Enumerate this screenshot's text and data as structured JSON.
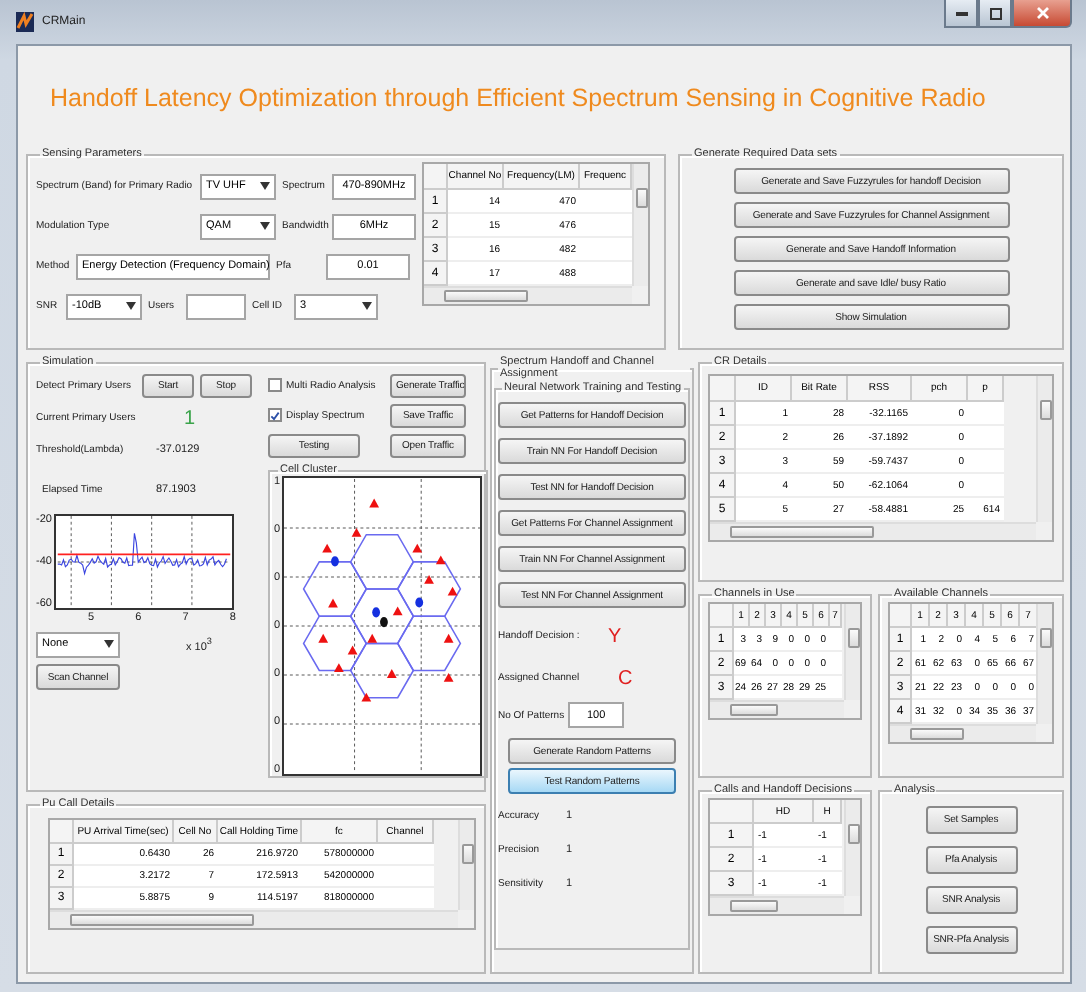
{
  "window": {
    "title": "CRMain"
  },
  "heading": "Handoff Latency Optimization  through Efficient Spectrum Sensing in Cognitive Radio",
  "sensing": {
    "title": "Sensing Parameters",
    "lines": [
      {
        "controls": [
          {
            "kind": "dropdown",
            "label": "Spectrum (Band) for Primary Radio",
            "value": "TV UHF"
          },
          {
            "kind": "input",
            "label": "Spectrum",
            "value": "470-890MHz"
          }
        ]
      },
      {
        "controls": [
          {
            "kind": "dropdown",
            "label": "Modulation Type",
            "value": "QAM"
          },
          {
            "kind": "input",
            "label": "Bandwidth",
            "value": "6MHz"
          }
        ]
      },
      {
        "controls": [
          {
            "kind": "dropdown",
            "label": "Method",
            "value": "Energy Detection (Frequency Domain)"
          },
          {
            "kind": "input",
            "label": "Pfa",
            "value": "0.01"
          }
        ]
      },
      {
        "controls": [
          {
            "kind": "dropdown",
            "label": "SNR",
            "value": "-10dB"
          },
          {
            "kind": "input",
            "label": "Users"
          },
          {
            "kind": "dropdown",
            "label": "Cell ID",
            "value": "3"
          }
        ]
      }
    ],
    "table": {
      "columns": [
        "Channel No",
        "Frequency(LM)",
        "Frequenc"
      ],
      "rows": [
        {
          "header": "1",
          "cells": [
            "14",
            "470"
          ]
        },
        {
          "header": "2",
          "cells": [
            "15",
            "476"
          ]
        },
        {
          "header": "3",
          "cells": [
            "16",
            "482"
          ]
        },
        {
          "header": "4",
          "cells": [
            "17",
            "488"
          ]
        }
      ]
    }
  },
  "generate": {
    "title": "Generate Required Data sets",
    "buttons": [
      "Generate and Save  Fuzzyrules for handoff Decision",
      "Generate and Save Fuzzyrules for Channel Assignment",
      "Generate and Save Handoff Information",
      "Generate and save Idle/ busy Ratio",
      "Show Simulation"
    ]
  },
  "simulation": {
    "title": "Simulation",
    "detect": {
      "label": "Detect Primary Users",
      "start": "Start",
      "stop": "Stop"
    },
    "checks": [
      {
        "label": "Multi Radio Analysis",
        "checked": false
      },
      {
        "label": "Display Spectrum",
        "checked": true
      }
    ],
    "traffic_buttons": [
      "Generate Traffic",
      "Save Traffic",
      "Open Traffic"
    ],
    "testing": "Testing",
    "stats": [
      {
        "label": "Current Primary Users",
        "value": "1"
      },
      {
        "label": "Threshold(Lambda)",
        "value": "-37.0129"
      },
      {
        "label": "Elapsed Time",
        "value": "87.1903"
      }
    ],
    "plot": {
      "yticks": [
        "-20",
        "-40",
        "-60"
      ],
      "xticks": [
        "5",
        "6",
        "7",
        "8"
      ],
      "scale": "x 10$^{3}$"
    },
    "view": "None",
    "scan": "Scan Channel",
    "cluster": {
      "title": "Cell Cluster",
      "yticks": [
        "1",
        "0",
        "0",
        "0",
        "0",
        "0",
        "0"
      ]
    }
  },
  "pu_calls": {
    "title": "Pu Call Details",
    "table": {
      "columns": [
        "PU Arrival Time(sec)",
        "Cell No",
        "Call Holding Time",
        "fc",
        "Channel"
      ],
      "rows": [
        {
          "header": "1",
          "cells": [
            "0.6430",
            "26",
            "216.9720",
            "578000000"
          ]
        },
        {
          "header": "2",
          "cells": [
            "3.2172",
            "7",
            "172.5913",
            "542000000"
          ]
        },
        {
          "header": "3",
          "cells": [
            "5.8875",
            "9",
            "114.5197",
            "818000000"
          ]
        }
      ]
    }
  },
  "handoff": {
    "title": "Spectrum Handoff and Channel Assignment",
    "nn": {
      "title": "Neural Network Training and Testing",
      "buttons": [
        "Get Patterns for Handoff Decision",
        "Train NN For Handoff Decision",
        "Test NN  for Handoff Decision",
        "Get Patterns For Channel Assignment",
        "Train NN For Channel Assignment",
        "Test NN For Channel Assignment"
      ],
      "results": [
        {
          "label": "Handoff Decision :",
          "value": "Y"
        },
        {
          "label": "Assigned Channel",
          "value": "C"
        }
      ],
      "patterns": {
        "label": "No Of Patterns",
        "value": "100"
      },
      "actions": [
        {
          "label": "Generate Random Patterns",
          "focused": false
        },
        {
          "label": "Test Random Patterns",
          "focused": true
        }
      ],
      "metrics": [
        {
          "label": "Accuracy",
          "value": "1"
        },
        {
          "label": "Precision",
          "value": "1"
        },
        {
          "label": "Sensitivity",
          "value": "1"
        }
      ]
    }
  },
  "cr_details": {
    "title": "CR Details",
    "table": {
      "columns": [
        "ID",
        "Bit Rate",
        "RSS",
        "pch",
        "p"
      ],
      "rows": [
        {
          "header": "1",
          "cells": [
            "1",
            "28",
            "-32.1165",
            "0"
          ]
        },
        {
          "header": "2",
          "cells": [
            "2",
            "26",
            "-37.1892",
            "0"
          ]
        },
        {
          "header": "3",
          "cells": [
            "3",
            "59",
            "-59.7437",
            "0"
          ]
        },
        {
          "header": "4",
          "cells": [
            "4",
            "50",
            "-62.1064",
            "0"
          ]
        },
        {
          "header": "5",
          "cells": [
            "5",
            "27",
            "-58.4881",
            "25",
            "614"
          ]
        }
      ]
    }
  },
  "channels_in_use": {
    "title": "Channels in Use",
    "table": {
      "columns": [
        "1",
        "2",
        "3",
        "4",
        "5",
        "6",
        "7"
      ],
      "rows": [
        {
          "header": "1",
          "cells": [
            "3",
            "3",
            "9",
            "0",
            "0",
            "0"
          ]
        },
        {
          "header": "2",
          "cells": [
            "69",
            "64",
            "0",
            "0",
            "0",
            "0"
          ]
        },
        {
          "header": "3",
          "cells": [
            "24",
            "26",
            "27",
            "28",
            "29",
            "25"
          ]
        }
      ]
    }
  },
  "available_channels": {
    "title": "Available Channels",
    "table": {
      "columns": [
        "1",
        "2",
        "3",
        "4",
        "5",
        "6",
        "7"
      ],
      "rows": [
        {
          "header": "1",
          "cells": [
            "1",
            "2",
            "0",
            "4",
            "5",
            "6",
            "7"
          ]
        },
        {
          "header": "2",
          "cells": [
            "61",
            "62",
            "63",
            "0",
            "65",
            "66",
            "67"
          ]
        },
        {
          "header": "3",
          "cells": [
            "21",
            "22",
            "23",
            "0",
            "0",
            "0",
            "0"
          ]
        },
        {
          "header": "4",
          "cells": [
            "31",
            "32",
            "0",
            "34",
            "35",
            "36",
            "37"
          ]
        }
      ]
    }
  },
  "calls_decisions": {
    "title": "Calls and Handoff Decisions",
    "table": {
      "columns": [
        "HD",
        "H"
      ],
      "rows": [
        {
          "header": "1",
          "cells": [
            "-1",
            "-1"
          ]
        },
        {
          "header": "2",
          "cells": [
            "-1",
            "-1"
          ]
        },
        {
          "header": "3",
          "cells": [
            "-1",
            "-1"
          ]
        }
      ]
    }
  },
  "analysis": {
    "title": "Analysis",
    "buttons": [
      "Set Samples",
      "Pfa Analysis",
      "SNR Analysis",
      "SNR-Pfa Analysis"
    ]
  }
}
